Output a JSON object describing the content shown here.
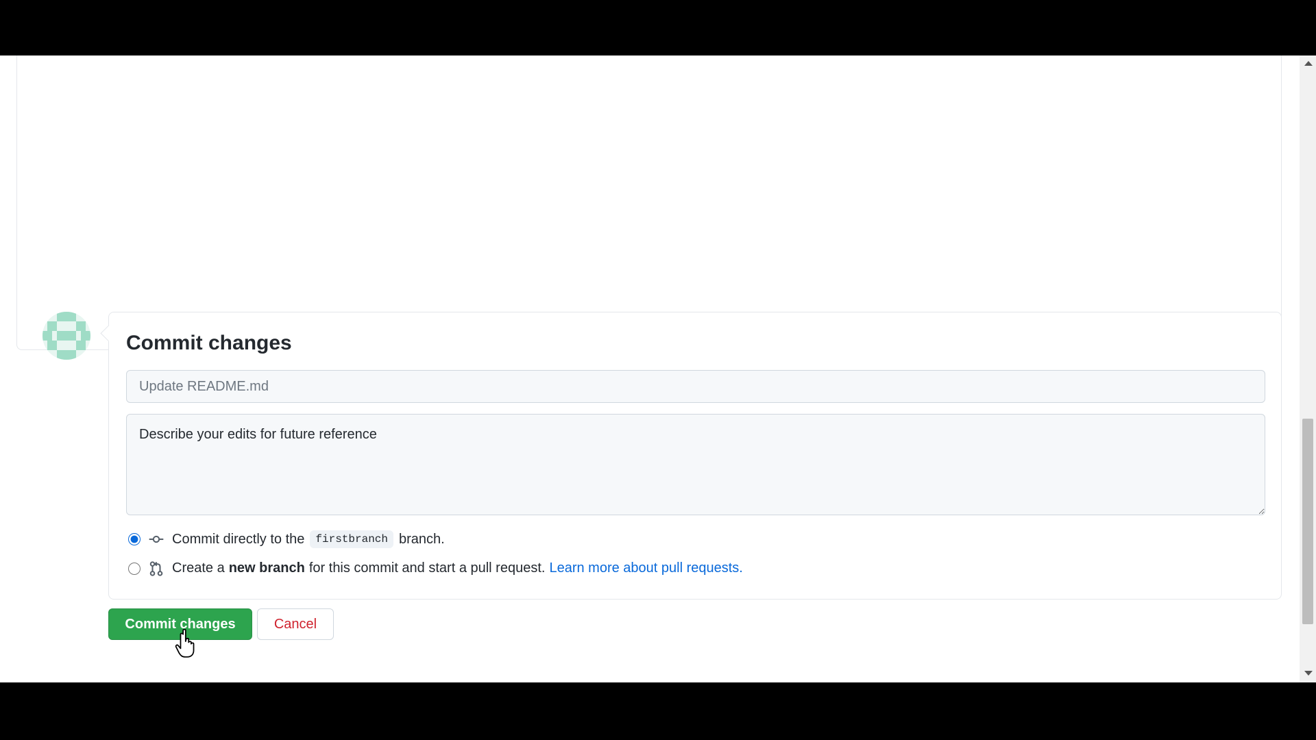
{
  "commit_form": {
    "title": "Commit changes",
    "summary_placeholder": "Update README.md",
    "description_placeholder": "Describe your edits for future reference",
    "option_direct": {
      "prefix": "Commit directly to the",
      "branch": "firstbranch",
      "suffix": "branch.",
      "selected": true
    },
    "option_new_branch": {
      "prefix": "Create a",
      "bold": "new branch",
      "suffix": "for this commit and start a pull request.",
      "link": "Learn more about pull requests.",
      "selected": false
    }
  },
  "buttons": {
    "commit_label": "Commit changes",
    "cancel_label": "Cancel"
  },
  "icons": {
    "commit_icon": "git-commit-icon",
    "pull_request_icon": "git-pull-request-icon"
  },
  "colors": {
    "primary_green": "#2da44e",
    "cancel_red": "#cf222e",
    "link_blue": "#0969da"
  }
}
